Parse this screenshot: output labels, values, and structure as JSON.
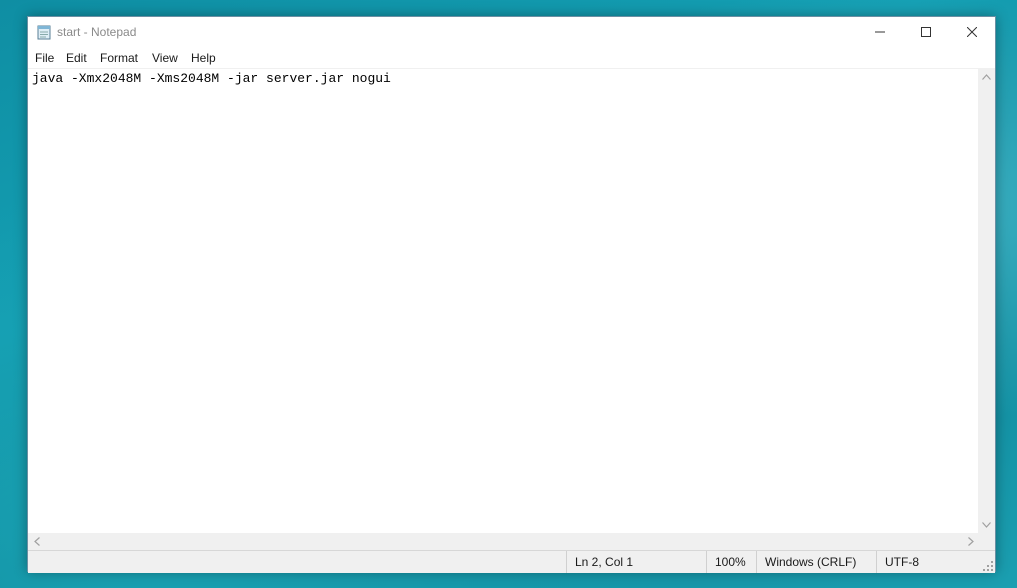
{
  "window": {
    "title": "start - Notepad",
    "icon": "notepad-icon",
    "controls": {
      "minimize": "minimize-icon",
      "maximize": "maximize-icon",
      "close": "close-icon"
    }
  },
  "menu": {
    "items": [
      {
        "label": "File"
      },
      {
        "label": "Edit"
      },
      {
        "label": "Format"
      },
      {
        "label": "View"
      },
      {
        "label": "Help"
      }
    ]
  },
  "editor": {
    "content": "java -Xmx2048M -Xms2048M -jar server.jar nogui"
  },
  "status": {
    "position": "Ln 2, Col 1",
    "zoom": "100%",
    "line_ending": "Windows (CRLF)",
    "encoding": "UTF-8"
  },
  "colors": {
    "desktop": "#149fb3",
    "window_bg": "#ffffff",
    "chrome": "#f0f0f0"
  }
}
